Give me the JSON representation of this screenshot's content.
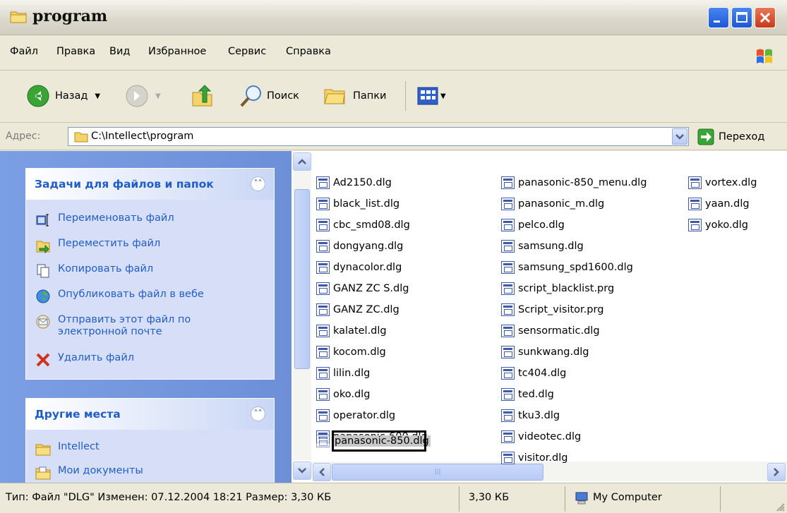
{
  "window": {
    "title": "program"
  },
  "menu": [
    "Файл",
    "Правка",
    "Вид",
    "Избранное",
    "Сервис",
    "Справка"
  ],
  "toolbar": {
    "back": "Назад",
    "search": "Поиск",
    "folders": "Папки"
  },
  "address": {
    "label": "Адрес:",
    "value": "C:\\Intellect\\program",
    "go": "Переход"
  },
  "tasks_panel": {
    "title": "Задачи для файлов и папок",
    "items": [
      {
        "label": "Переименовать файл",
        "icon": "rename-icon"
      },
      {
        "label": "Переместить файл",
        "icon": "move-icon"
      },
      {
        "label": "Копировать файл",
        "icon": "copy-icon"
      },
      {
        "label": "Опубликовать файл в вебе",
        "icon": "publish-web-icon"
      },
      {
        "label": "Отправить этот файл по",
        "label2": "электронной почте",
        "icon": "email-icon"
      },
      {
        "label": "Удалить файл",
        "icon": "delete-icon"
      }
    ]
  },
  "places_panel": {
    "title": "Другие места",
    "items": [
      {
        "label": "Intellect",
        "icon": "folder-icon"
      },
      {
        "label": "Мои документы",
        "icon": "my-documents-icon"
      }
    ]
  },
  "files": {
    "col1": [
      "Ad2150.dlg",
      "black_list.dlg",
      "cbc_smd08.dlg",
      "dongyang.dlg",
      "dynacolor.dlg",
      "GANZ ZC S.dlg",
      "GANZ ZC.dlg",
      "kalatel.dlg",
      "kocom.dlg",
      "lilin.dlg",
      "oko.dlg",
      "operator.dlg",
      "panasonic-600.dlg"
    ],
    "selected_name": "panasonic-850",
    "selected_ext": "dlg",
    "col2": [
      "panasonic-850_menu.dlg",
      "panasonic_m.dlg",
      "pelco.dlg",
      "samsung.dlg",
      "samsung_spd1600.dlg",
      "script_blacklist.prg",
      "Script_visitor.prg",
      "sensormatic.dlg",
      "sunkwang.dlg",
      "tc404.dlg",
      "ted.dlg",
      "tku3.dlg",
      "videotec.dlg",
      "visitor.dlg"
    ],
    "col3": [
      "vortex.dlg",
      "yaan.dlg",
      "yoko.dlg"
    ]
  },
  "status": {
    "info": "Тип: Файл \"DLG\" Изменен: 07.12.2004 18:21 Размер: 3,30 КБ",
    "size": "3,30 КБ",
    "location": "My Computer"
  }
}
